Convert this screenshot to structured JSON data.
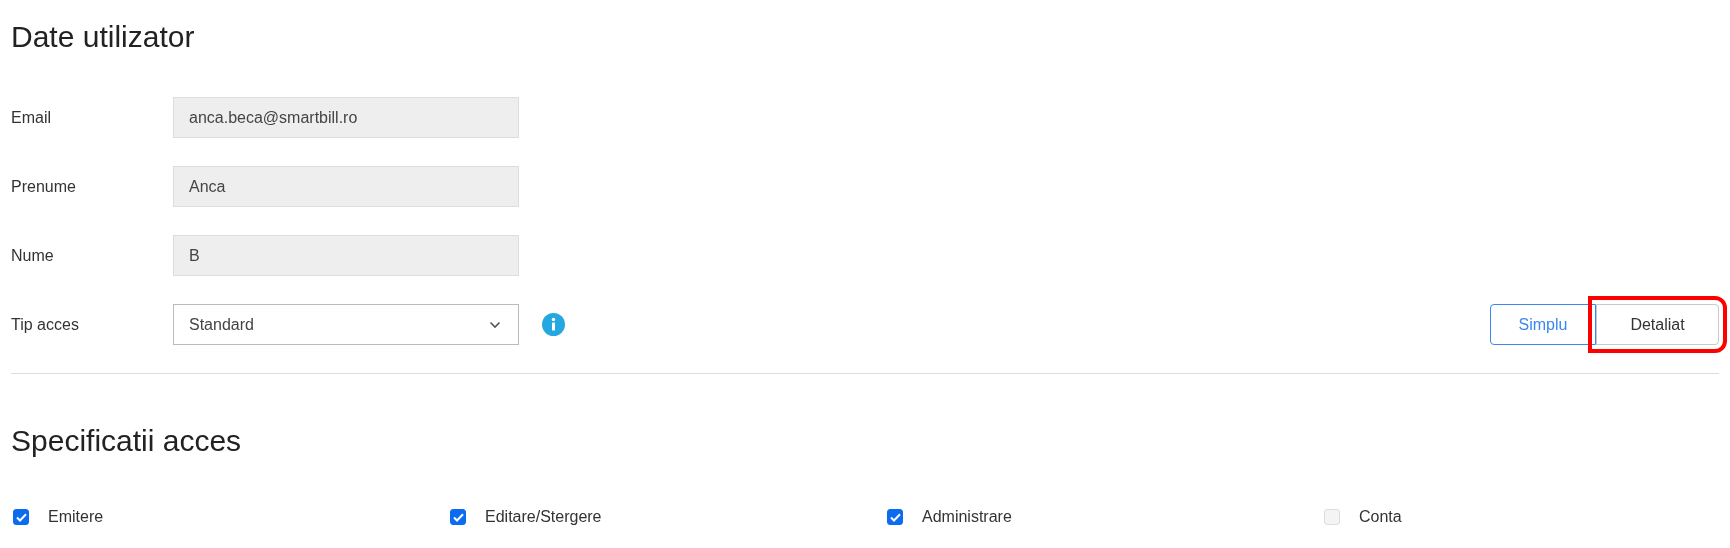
{
  "user_section": {
    "title": "Date utilizator",
    "fields": [
      {
        "label": "Email",
        "value": "anca.beca@smartbill.ro",
        "kind": "readonly"
      },
      {
        "label": "Prenume",
        "value": "Anca",
        "kind": "readonly"
      },
      {
        "label": "Nume",
        "value": "B",
        "kind": "readonly"
      },
      {
        "label": "Tip acces",
        "value": "Standard",
        "kind": "select"
      }
    ],
    "view_toggle": [
      {
        "label": "Simplu",
        "selected": true,
        "highlighted": false
      },
      {
        "label": "Detaliat",
        "selected": false,
        "highlighted": true
      }
    ]
  },
  "access_section": {
    "title": "Specificatii acces",
    "permissions": [
      {
        "label": "Emitere",
        "checked": true,
        "disabled": false
      },
      {
        "label": "Editare/Stergere",
        "checked": true,
        "disabled": false
      },
      {
        "label": "Administrare",
        "checked": true,
        "disabled": false
      },
      {
        "label": "Conta",
        "checked": false,
        "disabled": true
      }
    ]
  }
}
